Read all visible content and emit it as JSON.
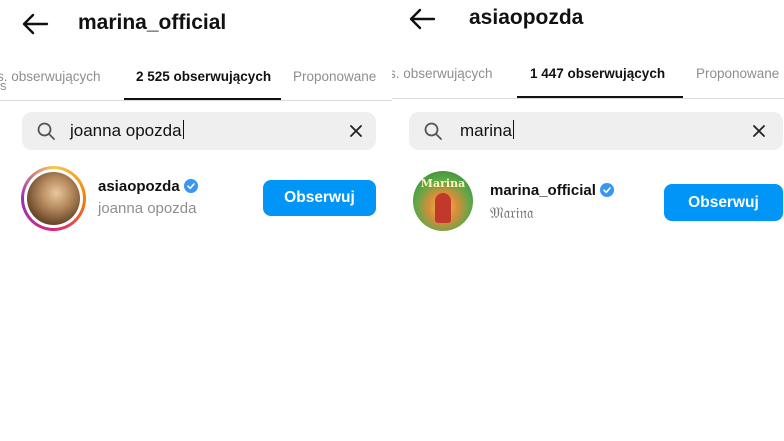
{
  "left": {
    "title": "marina_official",
    "tabs": [
      {
        "label": "s. obserwujących"
      },
      {
        "label": "2 525 obserwujących"
      },
      {
        "label": "Proponowane"
      }
    ],
    "search": {
      "value": "joanna opozda"
    },
    "result": {
      "username": "asiaopozda",
      "full_name": "joanna opozda",
      "button": "Obserwuj"
    },
    "edge_fragment": "s"
  },
  "right": {
    "title": "asiaopozda",
    "tabs": [
      {
        "label": "s. obserwujących"
      },
      {
        "label": "1 447 obserwujących"
      },
      {
        "label": "Proponowane"
      }
    ],
    "search": {
      "value": "marina"
    },
    "result": {
      "username": "marina_official",
      "full_name": "𝔐𝔞𝔯𝔦𝔫𝔞",
      "button": "Obserwuj",
      "avatar_text": "Marina"
    }
  },
  "colors": {
    "accent": "#0095f6",
    "verified": "#3897f0",
    "secondary_text": "#8e8e8e",
    "search_bg": "#efefef"
  },
  "icons": [
    "back-arrow-icon",
    "search-icon",
    "clear-icon",
    "verified-badge-icon"
  ]
}
